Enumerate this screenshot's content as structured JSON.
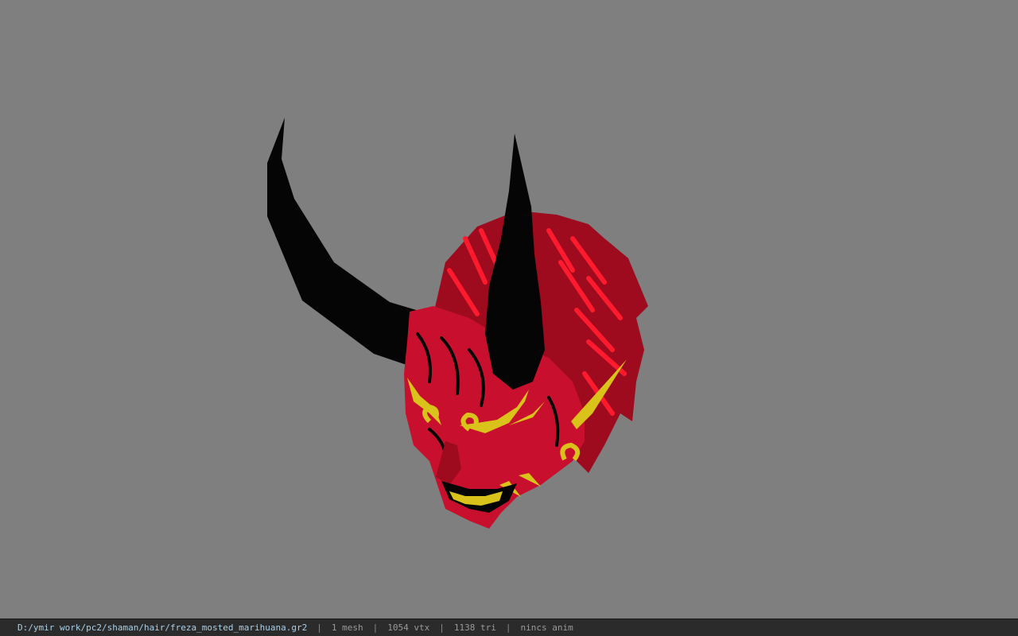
{
  "viewport": {
    "background": "#7f7f7f",
    "model": {
      "colors": {
        "horn": "#050505",
        "skin": "#c8102e",
        "hair": "#9e0a1e",
        "hair_highlight": "#ff1a2e",
        "gold": "#d9c21a"
      }
    }
  },
  "statusbar": {
    "file_path": "D:/ymir work/pc2/shaman/hair/freza_mosted_marihuana.gr2",
    "separator": "|",
    "mesh_count": "1 mesh",
    "vertex_count": "1054 vtx",
    "triangle_count": "1138 tri",
    "anim_status": "nincs anim"
  }
}
